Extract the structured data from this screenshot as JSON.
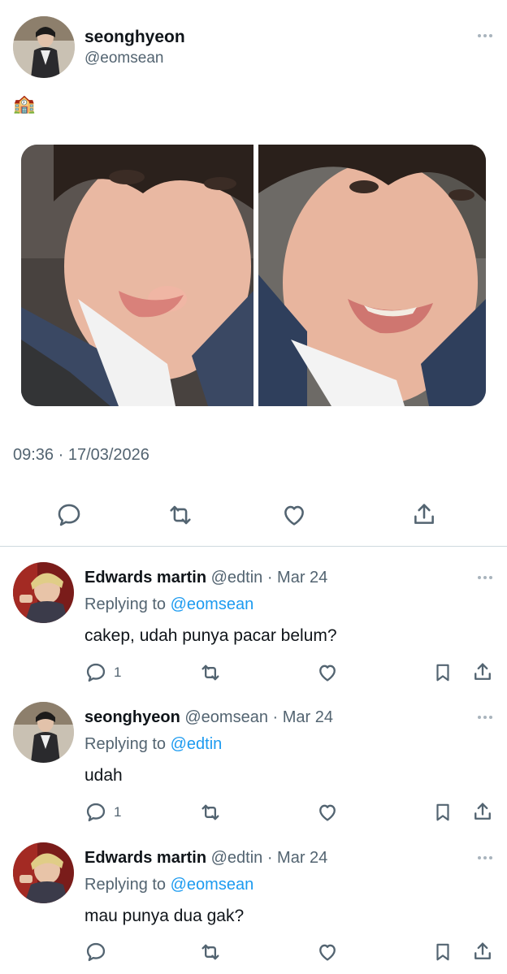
{
  "tweet": {
    "author_name": "seonghyeon",
    "author_handle": "@eomsean",
    "emoji": "🏫",
    "timestamp": "09:36 · 17/03/2026"
  },
  "replies": [
    {
      "name": "Edwards martin",
      "handle": "@edtin",
      "date": "· Mar 24",
      "replying_label": "Replying to",
      "replying_handle": "@eomsean",
      "text": "cakep, udah punya pacar belum?",
      "reply_count": "1"
    },
    {
      "name": "seonghyeon",
      "handle": "@eomsean",
      "date": "· Mar 24",
      "replying_label": "Replying to",
      "replying_handle": "@edtin",
      "text": "udah",
      "reply_count": "1"
    },
    {
      "name": "Edwards martin",
      "handle": "@edtin",
      "date": "· Mar 24",
      "replying_label": "Replying to",
      "replying_handle": "@eomsean",
      "text": "mau punya dua gak?",
      "reply_count": ""
    }
  ],
  "colors": {
    "accent": "#1d9bf0",
    "muted": "#536471",
    "text": "#0f1419"
  },
  "icons": [
    "reply-icon",
    "retweet-icon",
    "like-icon",
    "share-icon",
    "bookmark-icon",
    "more-icon"
  ]
}
